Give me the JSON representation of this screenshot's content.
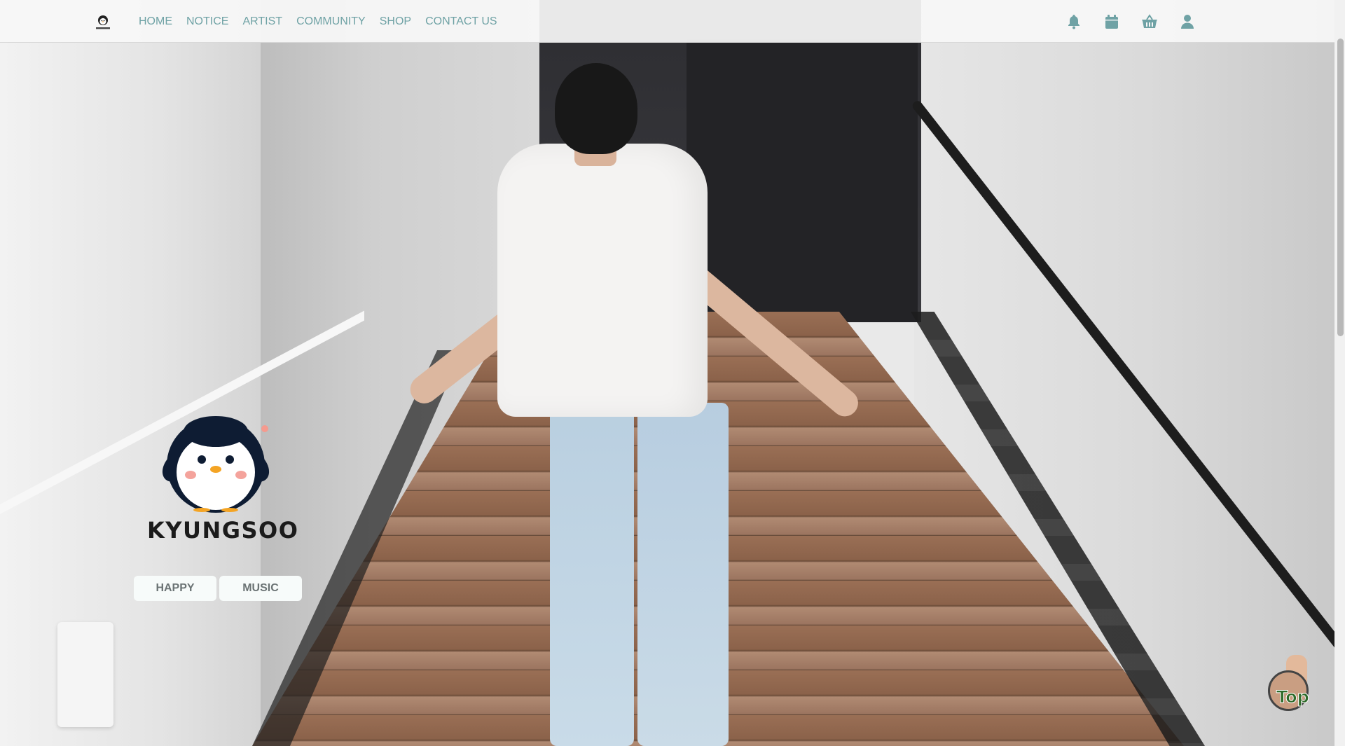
{
  "header": {
    "logo_text": "KYUNGSOO",
    "nav": [
      {
        "label": "HOME"
      },
      {
        "label": "NOTICE"
      },
      {
        "label": "ARTIST"
      },
      {
        "label": "COMMUNITY"
      },
      {
        "label": "SHOP"
      },
      {
        "label": "CONTACT US"
      }
    ],
    "icons": [
      "bell-icon",
      "calendar-icon",
      "basket-icon",
      "user-icon"
    ]
  },
  "hero": {
    "brand_name": "KYUNGSOO",
    "tags": [
      {
        "label": "HAPPY"
      },
      {
        "label": "MUSIC"
      }
    ]
  },
  "top_button": {
    "label": "Top"
  },
  "colors": {
    "nav_text": "#6fa2a5",
    "icon": "#6fa2a5",
    "tag_bg": "#f7fbfa",
    "tag_text": "#6b7374"
  }
}
